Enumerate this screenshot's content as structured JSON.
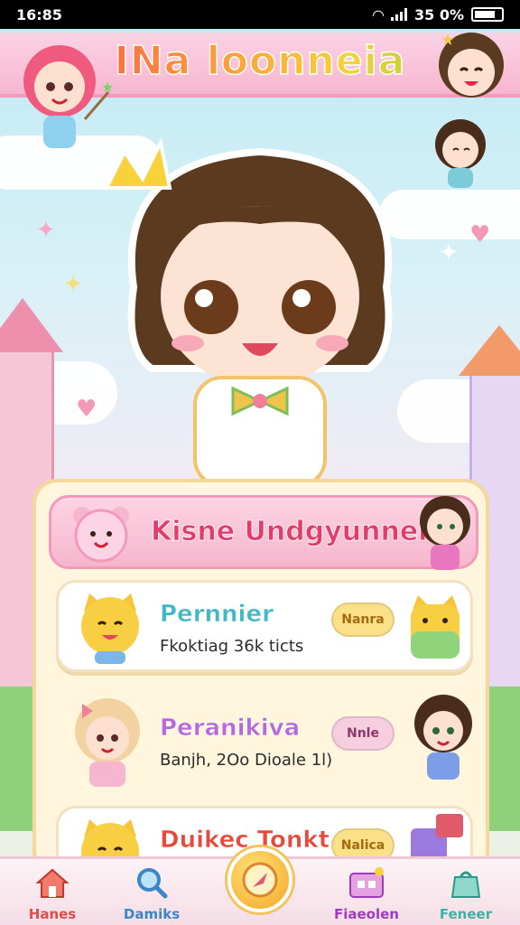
{
  "status_bar": {
    "time": "16:85",
    "battery": "35 0%"
  },
  "app": {
    "title": "INa loonneia"
  },
  "panel": {
    "title": "Kisne Undgyunnen",
    "items": [
      {
        "title": "Pernnier",
        "subtitle": "Fkoktiag 36k ticts",
        "badge": "Nanra",
        "title_color": "#3fb8c8",
        "badge_color": "#fbe08a"
      },
      {
        "title": "Peranikiva",
        "subtitle": "Banjh, 2Oo Dioale 1l)",
        "badge": "Nnle",
        "title_color": "#b66ad8",
        "badge_color": "#f7cde0"
      },
      {
        "title": "Duikec Tonkt",
        "subtitle": "",
        "badge": "Nalica",
        "title_color": "#e64a3c",
        "badge_color": "#fbe08a"
      }
    ]
  },
  "nav": {
    "items": [
      {
        "label": "Hanes",
        "icon": "home-icon",
        "color": "#e04b4b"
      },
      {
        "label": "Damiks",
        "icon": "search-icon",
        "color": "#3a86c8"
      },
      {
        "label": "Fiaeolen",
        "icon": "shop-icon",
        "color": "#a03bbf"
      },
      {
        "label": "Feneer",
        "icon": "bag-icon",
        "color": "#3bb2a4"
      }
    ],
    "center_icon": "compass-icon"
  },
  "colors": {
    "accent_pink": "#f39bbd",
    "panel_bg": "#fff6dd"
  }
}
